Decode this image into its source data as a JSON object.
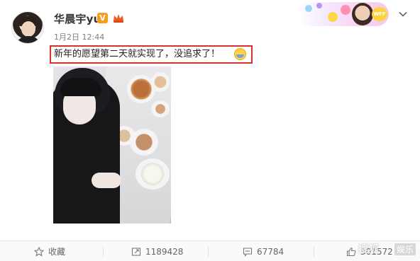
{
  "post": {
    "author": "华晨宇yu",
    "verified_badge": "V",
    "timestamp": "1月2日 12:44",
    "text": "新年的愿望第二天就实现了，没追求了！"
  },
  "banner": {
    "label": "WFF"
  },
  "actions": {
    "favorite": "收藏",
    "repost_count": "1189428",
    "comment_count": "67784",
    "like_count": "301572"
  },
  "watermark": {
    "left": "搜狐",
    "right": "娱乐"
  },
  "colors": {
    "highlight_border": "#d6322e",
    "verified": "#f79c1c"
  },
  "icons": [
    "star-icon",
    "repost-icon",
    "comment-icon",
    "thumbs-up-icon",
    "chevron-down-icon"
  ]
}
